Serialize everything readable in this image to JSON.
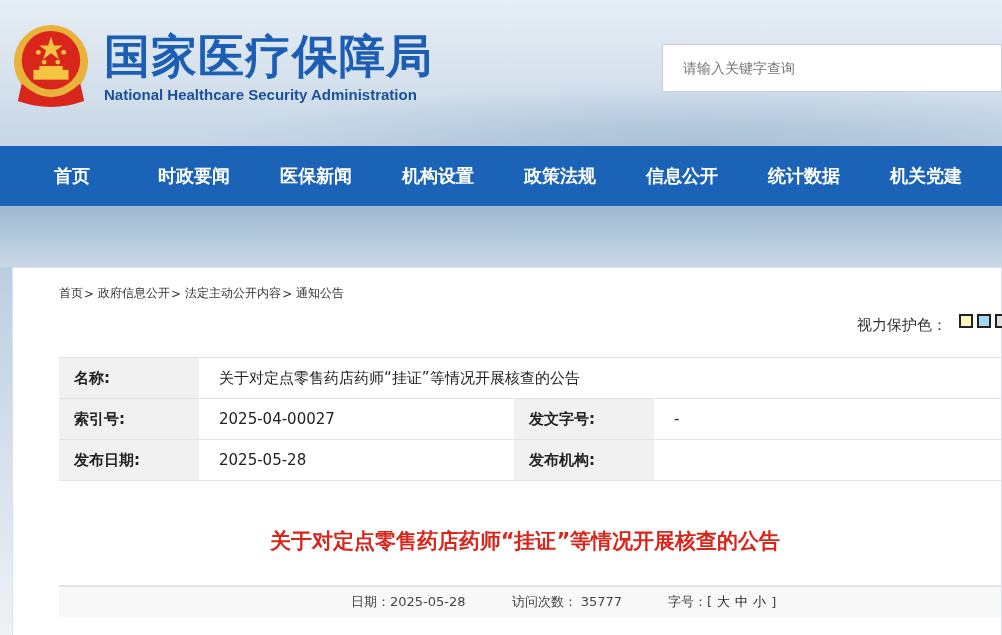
{
  "header": {
    "title": "国家医疗保障局",
    "subtitle": "National Healthcare Security Administration",
    "search": {
      "placeholder": "请输入关键字查询"
    }
  },
  "nav": [
    {
      "label": "首页"
    },
    {
      "label": "时政要闻"
    },
    {
      "label": "医保新闻"
    },
    {
      "label": "机构设置"
    },
    {
      "label": "政策法规"
    },
    {
      "label": "信息公开"
    },
    {
      "label": "统计数据"
    },
    {
      "label": "机关党建"
    }
  ],
  "breadcrumb": {
    "separator": ">",
    "items": [
      "首页",
      "政府信息公开",
      "法定主动公开内容",
      "通知公告"
    ]
  },
  "eye_care": {
    "label": "视力保护色：",
    "swatches": [
      {
        "color": "#fbf5c0"
      },
      {
        "color": "#a6d8f2"
      },
      {
        "color": "#e0e0e0"
      }
    ]
  },
  "meta": [
    [
      {
        "label": "名称:",
        "value": "关于对定点零售药店药师“挂证”等情况开展核查的公告"
      }
    ],
    [
      {
        "label": "索引号:",
        "value": "2025-04-00027"
      },
      {
        "label": "发文字号:",
        "value": "-"
      }
    ],
    [
      {
        "label": "发布日期:",
        "value": "2025-05-28"
      },
      {
        "label": "发布机构:"
      }
    ]
  ],
  "article": {
    "title": "关于对定点零售药店药师“挂证”等情况开展核查的公告",
    "date_label": "日期：",
    "date": "2025-05-28",
    "visits_label": "访问次数：",
    "visits": "35777",
    "font_size": {
      "label": "字号：",
      "open": "[",
      "options": [
        "大",
        "中",
        "小"
      ],
      "close": "]"
    }
  }
}
